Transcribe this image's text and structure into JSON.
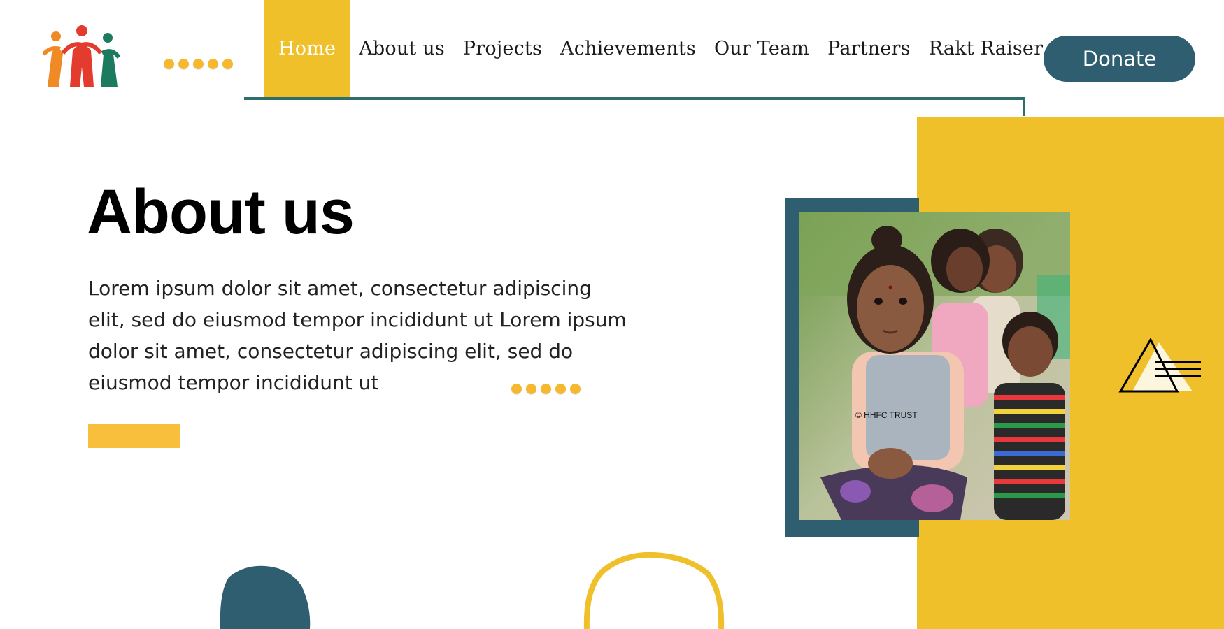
{
  "nav": {
    "items": [
      {
        "label": "Home",
        "active": true
      },
      {
        "label": "About us"
      },
      {
        "label": "Projects"
      },
      {
        "label": "Achievements"
      },
      {
        "label": "Our Team"
      },
      {
        "label": "Partners"
      },
      {
        "label": "Rakt Raiser"
      }
    ],
    "donate_label": "Donate"
  },
  "hero": {
    "title": "About us",
    "body": "Lorem ipsum dolor sit amet, consectetur adipiscing elit, sed do eiusmod tempor incididunt ut Lorem ipsum dolor sit amet, consectetur adipiscing elit, sed do eiusmod tempor incididunt ut"
  },
  "photo": {
    "watermark": "© HHFC TRUST"
  },
  "colors": {
    "accent_yellow": "#f0c02a",
    "navy": "#2e5e70",
    "teal_line": "#2f6e6a"
  },
  "icons": [
    "logo-people-icon",
    "dots-decoration",
    "triangle-lines-icon"
  ]
}
